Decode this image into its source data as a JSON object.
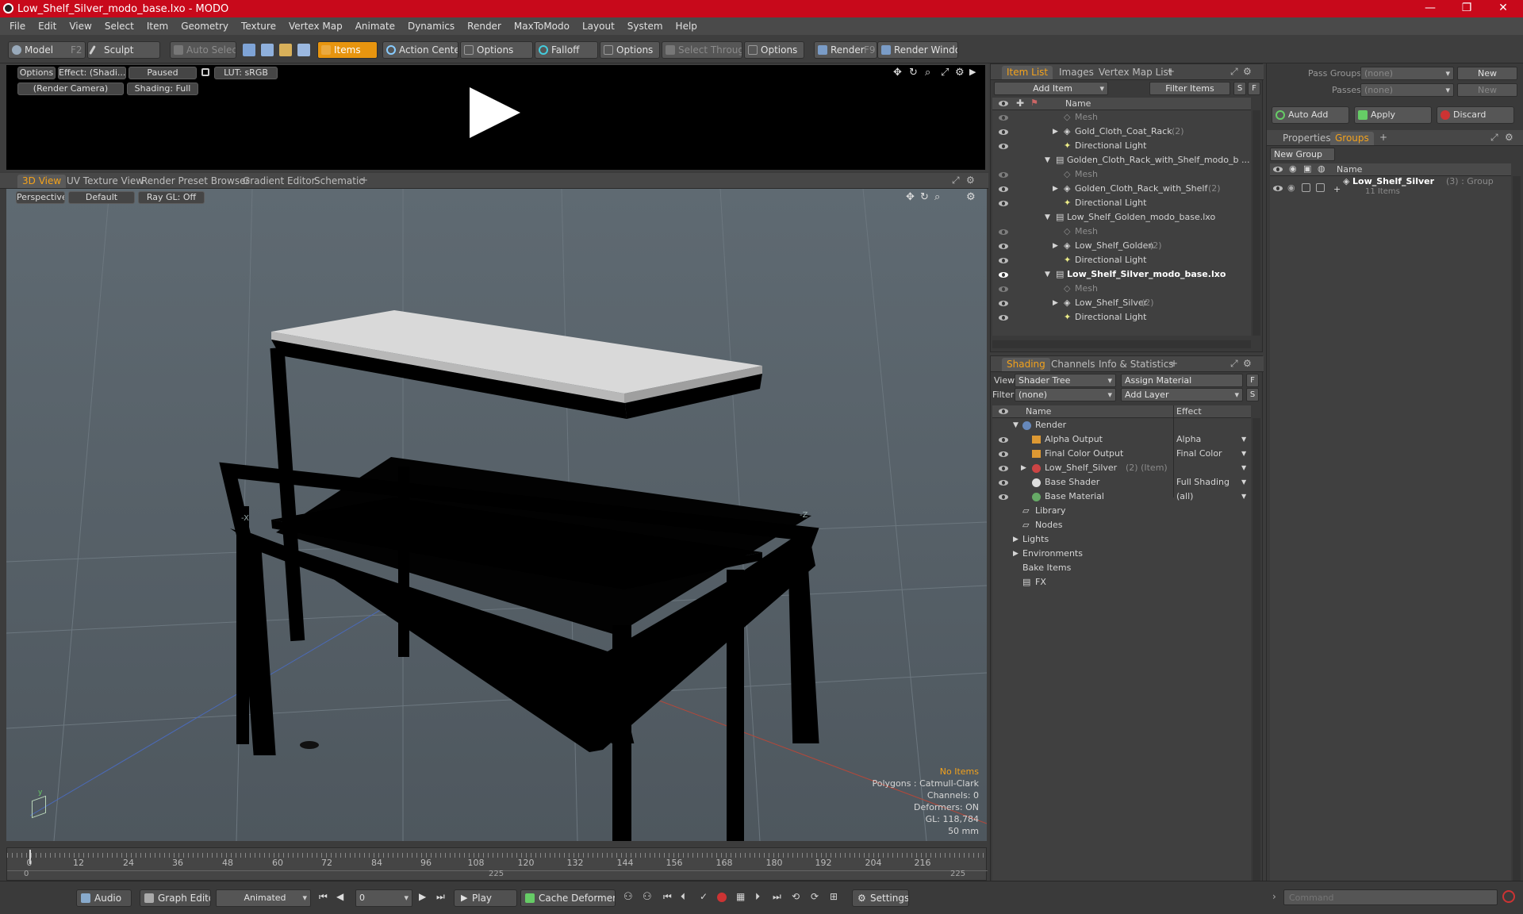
{
  "window": {
    "title": "Low_Shelf_Silver_modo_base.lxo - MODO",
    "minimize": "—",
    "maximize": "❐",
    "close": "✕"
  },
  "menu": [
    "File",
    "Edit",
    "View",
    "Select",
    "Item",
    "Geometry",
    "Texture",
    "Vertex Map",
    "Animate",
    "Dynamics",
    "Render",
    "MaxToModo",
    "Layout",
    "System",
    "Help"
  ],
  "toolbar": {
    "model": "Model",
    "model_key": "F2",
    "sculpt": "Sculpt",
    "auto_select": "Auto Select",
    "items": "Items",
    "action_center": "Action Center",
    "options1": "Options",
    "falloff": "Falloff",
    "options2": "Options",
    "select_through": "Select Through",
    "options3": "Options",
    "render": "Render",
    "render_key": "F9",
    "render_window": "Render Window"
  },
  "preview": {
    "options": "Options",
    "effect": "Effect: (Shadi...",
    "paused": "Paused",
    "lut": "LUT: sRGB",
    "camera": "(Render Camera)",
    "shading": "Shading: Full"
  },
  "viewport": {
    "tabs": [
      "3D View",
      "UV Texture View",
      "Render Preset Browser",
      "Gradient Editor",
      "Schematic"
    ],
    "perspective": "Perspective",
    "default": "Default",
    "raygl": "Ray GL: Off",
    "info": {
      "no_items": "No Items",
      "polygons": "Polygons : Catmull-Clark",
      "channels": "Channels: 0",
      "deformers": "Deformers: ON",
      "gl": "GL: 118,784",
      "scale": "50 mm"
    },
    "axis_labels": {
      "x1": "-X",
      "x2": "-Z"
    }
  },
  "item_list": {
    "tabs": [
      "Item List",
      "Images",
      "Vertex Map List"
    ],
    "add_item": "Add Item",
    "filter_items": "Filter Items",
    "s": "S",
    "f": "F",
    "name_header": "Name",
    "rows": [
      {
        "label": "Mesh",
        "count": "",
        "kind": "mesh"
      },
      {
        "label": "Gold_Cloth_Coat_Rack",
        "count": "(2)",
        "kind": "group"
      },
      {
        "label": "Directional Light",
        "count": "",
        "kind": "light"
      },
      {
        "label": "Golden_Cloth_Rack_with_Shelf_modo_b ...",
        "count": "",
        "kind": "scene"
      },
      {
        "label": "Mesh",
        "count": "",
        "kind": "mesh"
      },
      {
        "label": "Golden_Cloth_Rack_with_Shelf",
        "count": "(2)",
        "kind": "group"
      },
      {
        "label": "Directional Light",
        "count": "",
        "kind": "light"
      },
      {
        "label": "Low_Shelf_Golden_modo_base.lxo",
        "count": "",
        "kind": "scene"
      },
      {
        "label": "Mesh",
        "count": "",
        "kind": "mesh"
      },
      {
        "label": "Low_Shelf_Golden",
        "count": "(2)",
        "kind": "group"
      },
      {
        "label": "Directional Light",
        "count": "",
        "kind": "light"
      },
      {
        "label": "Low_Shelf_Silver_modo_base.lxo",
        "count": "",
        "kind": "scene-bold"
      },
      {
        "label": "Mesh",
        "count": "",
        "kind": "mesh"
      },
      {
        "label": "Low_Shelf_Silver",
        "count": "(2)",
        "kind": "group"
      },
      {
        "label": "Directional Light",
        "count": "",
        "kind": "light"
      }
    ]
  },
  "shading": {
    "tabs": [
      "Shading",
      "Channels",
      "Info & Statistics"
    ],
    "view_label": "View",
    "view_value": "Shader Tree",
    "assign_material": "Assign Material",
    "f": "F",
    "filter_label": "Filter",
    "filter_value": "(none)",
    "add_layer": "Add Layer",
    "s": "S",
    "name_header": "Name",
    "effect_header": "Effect",
    "rows": [
      {
        "label": "Render",
        "effect": ""
      },
      {
        "label": "Alpha Output",
        "effect": "Alpha"
      },
      {
        "label": "Final Color Output",
        "effect": "Final Color"
      },
      {
        "label": "Low_Shelf_Silver",
        "extra": "(2) (Item)",
        "effect": ""
      },
      {
        "label": "Base Shader",
        "effect": "Full Shading"
      },
      {
        "label": "Base Material",
        "effect": "(all)"
      },
      {
        "label": "Library",
        "effect": ""
      },
      {
        "label": "Nodes",
        "effect": ""
      },
      {
        "label": "Lights",
        "effect": ""
      },
      {
        "label": "Environments",
        "effect": ""
      },
      {
        "label": "Bake Items",
        "effect": ""
      },
      {
        "label": "FX",
        "effect": ""
      }
    ]
  },
  "groups_panel": {
    "pass_groups_label": "Pass Groups",
    "pass_groups_value": "(none)",
    "new": "New",
    "passes_label": "Passes",
    "passes_value": "(none)",
    "new2": "New",
    "auto_add": "Auto Add",
    "apply": "Apply",
    "discard": "Discard",
    "tabs": [
      "Properties",
      "Groups"
    ],
    "new_group": "New Group",
    "name_header": "Name",
    "group_name": "Low_Shelf_Silver",
    "group_meta": "(3) : Group",
    "group_items": "11 Items"
  },
  "timeline": {
    "ticks": [
      "0",
      "12",
      "24",
      "36",
      "48",
      "60",
      "72",
      "84",
      "96",
      "108",
      "120",
      "132",
      "144",
      "156",
      "168",
      "180",
      "192",
      "204",
      "216"
    ],
    "start": "0",
    "mid": "225",
    "end": "225"
  },
  "statusbar": {
    "audio": "Audio",
    "graph_editor": "Graph Editor",
    "animated": "Animated",
    "frame": "0",
    "play": "Play",
    "cache_deformers": "Cache Deformers",
    "settings": "Settings",
    "command_placeholder": "Command"
  },
  "colors": {
    "accent": "#f3a21c",
    "title_red": "#c8091b"
  }
}
